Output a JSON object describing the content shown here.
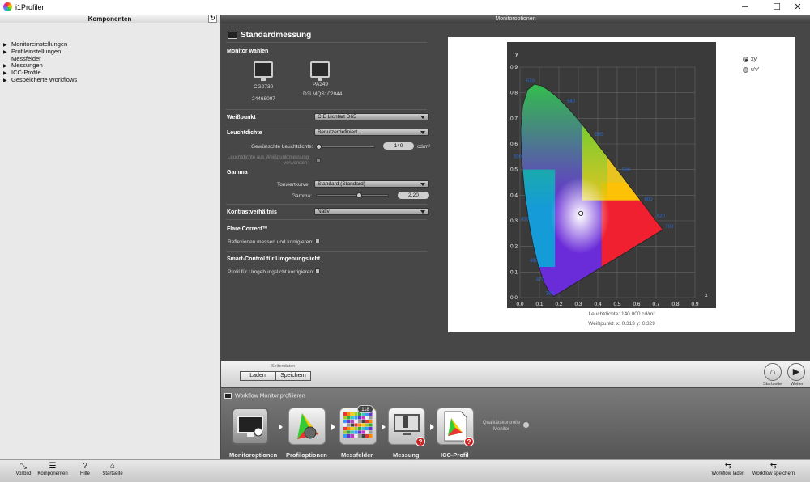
{
  "window": {
    "title": "i1Profiler"
  },
  "left_panel": {
    "title": "Komponenten",
    "items": [
      {
        "label": "Monitoreinstellungen",
        "expandable": true
      },
      {
        "label": "Profileinstellungen",
        "expandable": true
      },
      {
        "label": "Messfelder",
        "expandable": false
      },
      {
        "label": "Messungen",
        "expandable": true
      },
      {
        "label": "ICC-Profile",
        "expandable": true
      },
      {
        "label": "Gespeicherte Workflows",
        "expandable": true
      }
    ]
  },
  "main": {
    "header": "Monitoroptionen",
    "section_title": "Standardmessung",
    "monitor_select": {
      "label": "Monitor wählen",
      "monitors": [
        {
          "name": "CG2730",
          "serial": "24468097"
        },
        {
          "name": "PA249",
          "serial": "D3LMQS102044"
        }
      ]
    },
    "whitepoint": {
      "label": "Weißpunkt",
      "value": "CIE Lichtart D65"
    },
    "luminance": {
      "label": "Leuchtdichte",
      "value": "Benutzerdefiniert...",
      "slider_label": "Gewünschte Leuchtdichte:",
      "slider_value": "140",
      "unit": "cd/m²",
      "disabled_option": "Leuchtdichte aus Weißpunktmessung verwenden:"
    },
    "gamma": {
      "label": "Gamma",
      "curve_label": "Tonwertkurve:",
      "curve_value": "Standard (Standard)",
      "gamma_label": "Gamma:",
      "gamma_value": "2,20"
    },
    "contrast": {
      "label": "Kontrastverhältnis",
      "value": "Nativ"
    },
    "flare": {
      "label": "Flare Correct™",
      "option": "Reflexionen messen und korrigieren:"
    },
    "smart": {
      "label": "Smart-Control für Umgebungslicht",
      "option": "Profil für Umgebungslicht korrigieren:"
    }
  },
  "chart": {
    "radio_xy": "xy",
    "radio_uv": "u'v'",
    "x_ticks": [
      "0.0",
      "0.1",
      "0.2",
      "0.3",
      "0.4",
      "0.5",
      "0.6",
      "0.7",
      "0.8",
      "0.9"
    ],
    "y_ticks": [
      "0.9",
      "0.8",
      "0.7",
      "0.6",
      "0.5",
      "0.4",
      "0.3",
      "0.2",
      "0.1",
      "0.0"
    ],
    "x_label": "x",
    "y_label": "y",
    "wavelengths": [
      "520",
      "540",
      "560",
      "580",
      "500",
      "600",
      "620",
      "700",
      "490",
      "480",
      "470",
      "380"
    ],
    "luminance_caption": "Leuchtdichte: 140.000 cd/m²",
    "whitepoint_caption": "Weißpunkt: x: 0.313  y: 0.329"
  },
  "chart_data": {
    "type": "scatter",
    "title": "",
    "xlabel": "x",
    "ylabel": "y",
    "xlim": [
      0.0,
      0.9
    ],
    "ylim": [
      0.0,
      0.9
    ],
    "grid": true,
    "series": [
      {
        "values": [
          {
            "x": 0.313,
            "y": 0.329
          }
        ]
      }
    ]
  },
  "page_bar": {
    "title": "Seitendaten",
    "load": "Laden",
    "save": "Speichern",
    "home": "Startseite",
    "next": "Weiter"
  },
  "workflow": {
    "title": "Workflow Monitor profilieren",
    "badge": "118",
    "qc_label": "Qualitätskontrolle Monitor",
    "steps": [
      "Monitoroptionen",
      "Profiloptionen",
      "Messfelder",
      "Messung",
      "ICC-Profil"
    ]
  },
  "bottom": {
    "items": [
      "Vollbild",
      "Komponenten",
      "Hilfe",
      "Startseite"
    ],
    "right": [
      "Workflow laden",
      "Workflow speichern"
    ]
  }
}
